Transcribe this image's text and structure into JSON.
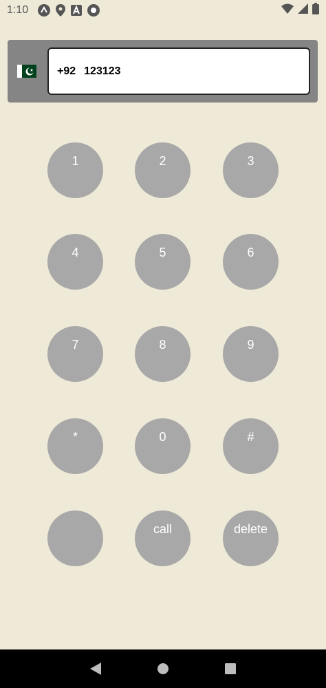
{
  "status_bar": {
    "time": "1:10",
    "icons_left": [
      "app-icon",
      "location-icon",
      "text-icon",
      "record-icon"
    ],
    "icons_right": [
      "wifi-icon",
      "signal-icon",
      "battery-icon"
    ]
  },
  "phone_input": {
    "country_flag": "pakistan-flag-icon",
    "country_code": "+92",
    "number": "123123"
  },
  "keypad": {
    "keys": [
      "1",
      "2",
      "3",
      "4",
      "5",
      "6",
      "7",
      "8",
      "9",
      "*",
      "0",
      "#",
      "",
      "call",
      "delete"
    ]
  },
  "colors": {
    "background": "#efe9d7",
    "key": "#a8a8a8",
    "input_bar": "#858585"
  },
  "nav_bar": {
    "buttons": [
      "back-icon",
      "home-icon",
      "recents-icon"
    ]
  }
}
